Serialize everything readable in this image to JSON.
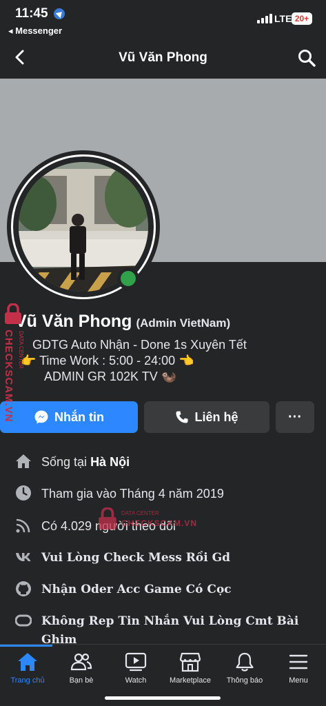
{
  "status_bar": {
    "time": "11:45",
    "back_app": "◂ Messenger",
    "network": "LTE",
    "battery": "20+"
  },
  "header": {
    "title": "Vũ Văn Phong",
    "back_icon": "chevron-left-icon",
    "search_icon": "search-icon"
  },
  "profile": {
    "name": "Vũ Văn Phong",
    "alternate_name": "(Admin VietNam)",
    "online": true,
    "bio": [
      "GDTG Auto Nhận - Done 1s Xuyên Tết",
      "👉 Time Work : 5:00 - 24:00 👈",
      "ADMIN GR 102K TV 🦦"
    ]
  },
  "actions": {
    "message_label": "Nhắn tin",
    "call_label": "Liên hệ",
    "more_label": "···"
  },
  "info": {
    "lives_prefix": "Sống tại ",
    "lives_city": "Hà Nội",
    "joined": "Tham gia vào Tháng 4 năm 2019",
    "followers": "Có 4.029 người theo dõi",
    "vk": "Vui Lòng Check Mess Rồi Gd",
    "github": "Nhận Oder Acc Game Có Cọc",
    "oculus_line1": "Không Rep Tin Nhắn Vui Lòng Cmt Bài",
    "oculus_line2": "Ghim"
  },
  "watermark": {
    "side": "CHECKSCAM.VN",
    "side_small": "DATA CENTER",
    "mid_small": "DATA CENTER",
    "mid": "CHECKSCAM.VN"
  },
  "tabs": [
    {
      "label": "Trang chủ",
      "icon": "home-icon",
      "active": true
    },
    {
      "label": "Bạn bè",
      "icon": "friends-icon",
      "active": false
    },
    {
      "label": "Watch",
      "icon": "watch-icon",
      "active": false
    },
    {
      "label": "Marketplace",
      "icon": "marketplace-icon",
      "active": false
    },
    {
      "label": "Thông báo",
      "icon": "bell-icon",
      "active": false
    },
    {
      "label": "Menu",
      "icon": "menu-icon",
      "active": false
    }
  ],
  "colors": {
    "background": "#242526",
    "accent": "#2d88ff",
    "secondary_button": "#3a3b3c",
    "online": "#31a24c",
    "cover": "#a8abae",
    "watermark": "#c2304a"
  }
}
